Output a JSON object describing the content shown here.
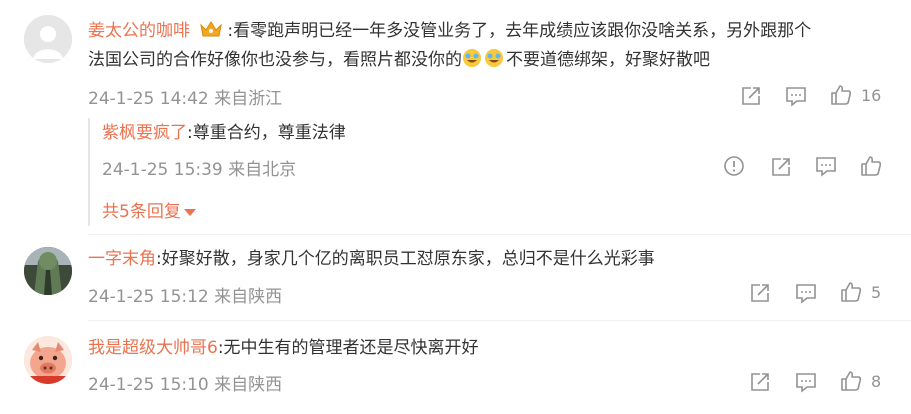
{
  "comments": [
    {
      "user": "姜太公的咖啡",
      "badge": "crown-badge-icon",
      "text_line1": ":看零跑声明已经一年多没管业务了，去年成绩应该跟你没啥关系，另外跟那个",
      "text_line2_a": "法国公司的合作好像你也没参与，看照片都没你的",
      "text_line2_b": "不要道德绑架，好聚好散吧",
      "emoji": "laugh-cry-emoji",
      "time": "24-1-25 14:42",
      "location": "来自浙江",
      "likes": "16",
      "reply": {
        "user": "紫枫要疯了",
        "text": ":尊重合约，尊重法律",
        "time": "24-1-25 15:39",
        "location": "来自北京"
      },
      "more_replies": "共5条回复"
    },
    {
      "user": "一字末角",
      "text": ":好聚好散，身家几个亿的离职员工怼原东家，总归不是什么光彩事",
      "time": "24-1-25 15:12",
      "location": "来自陕西",
      "likes": "5"
    },
    {
      "user": "我是超级大帅哥6",
      "text": ":无中生有的管理者还是尽快离开好",
      "time": "24-1-25 15:10",
      "location": "来自陕西",
      "likes": "8"
    }
  ],
  "colors": {
    "username": "#eb7350",
    "meta": "#939393",
    "text": "#333333"
  }
}
